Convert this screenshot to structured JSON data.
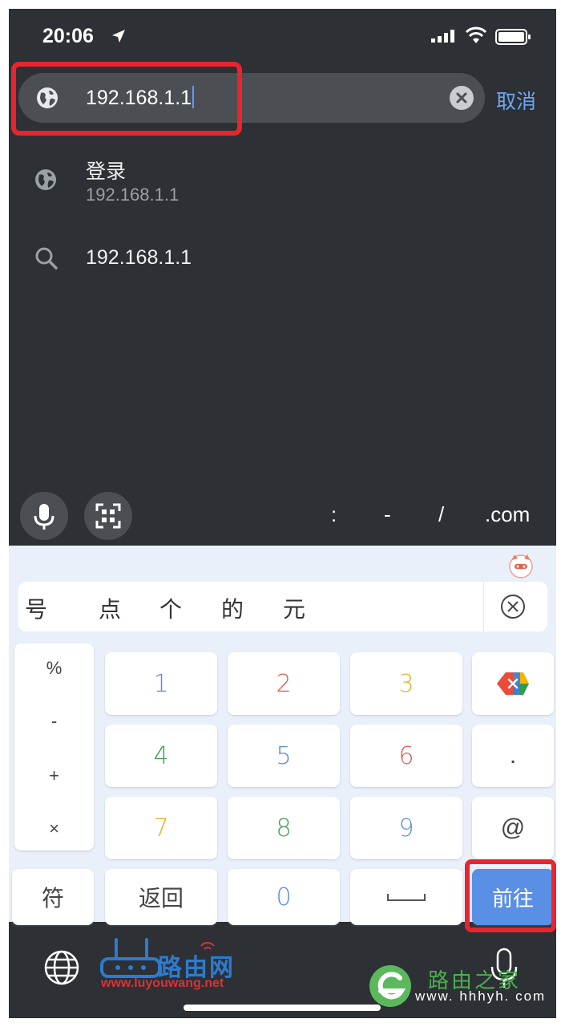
{
  "status_bar": {
    "time": "20:06"
  },
  "omnibox": {
    "url_text": "192.168.1.1",
    "cancel_label": "取消"
  },
  "suggestions": [
    {
      "title": "登录",
      "subtitle": "192.168.1.1",
      "icon": "globe-icon"
    },
    {
      "title": "192.168.1.1",
      "icon": "search-icon"
    }
  ],
  "accessory_keys": [
    ":",
    "-",
    "/",
    ".com"
  ],
  "candidates": [
    "号",
    "点",
    "个",
    "的",
    "元"
  ],
  "side_symbols": [
    "%",
    "-",
    "+",
    "×"
  ],
  "keys": {
    "k1": "1",
    "k2": "2",
    "k3": "3",
    "k4": "4",
    "k5": "5",
    "k6": "6",
    "k7": "7",
    "k8": "8",
    "k9": "9",
    "k0": "0",
    "dot": ".",
    "at": "@",
    "symbols": "符",
    "back": "返回",
    "go": "前往"
  },
  "key_colors": {
    "blue": "#5b8fd6",
    "red": "#e05a5a",
    "yellow": "#e6b12e",
    "green": "#3fa34d"
  },
  "watermarks": {
    "luyouwang_title": "路由网",
    "luyouwang_url": "www.luyouwang.net",
    "hhhyh_title": "路由之家",
    "hhhyh_url": "www. hhhyh. com"
  }
}
